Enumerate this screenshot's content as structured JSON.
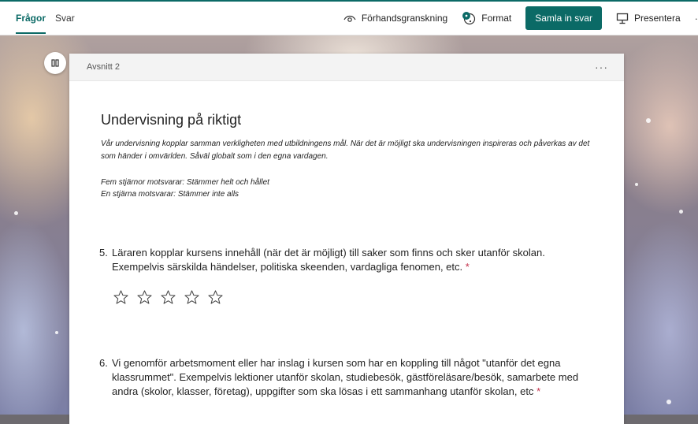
{
  "tabs": [
    {
      "label": "Frågor",
      "active": true
    },
    {
      "label": "Svar",
      "active": false
    }
  ],
  "toolbar": {
    "preview_label": "Förhandsgranskning",
    "format_label": "Format",
    "collect_label": "Samla in svar",
    "present_label": "Presentera"
  },
  "section": {
    "label": "Avsnitt 2",
    "menu": "···",
    "title": "Undervisning på riktigt",
    "description": "Vår undervisning kopplar samman verkligheten med utbildningens mål. När det är möjligt ska undervisningen inspireras och påverkas av det som händer i omvärlden. Såväl globalt som i den egna vardagen.",
    "scale_line1": "Fem stjärnor motsvarar: Stämmer helt och hållet",
    "scale_line2": "En stjärna motsvarar: Stämmer inte alls"
  },
  "questions": [
    {
      "number": "5.",
      "text": "Läraren kopplar kursens innehåll (när det är möjligt) till saker som finns och sker utanför skolan. Exempelvis särskilda händelser, politiska skeenden, vardagliga fenomen, etc.",
      "required_mark": "*",
      "rating_max": 5,
      "rating_value": 0
    },
    {
      "number": "6.",
      "text": "Vi genomför arbetsmoment eller har inslag i kursen som har en koppling till något \"utanför det egna klassrummet\". Exempelvis lektioner utanför skolan, studiebesök, gästföreläsare/besök, samarbete med andra (skolor, klasser, företag), uppgifter som ska lösas i ett sammanhang utanför skolan, etc",
      "required_mark": "*"
    }
  ],
  "colors": {
    "accent": "#0b6a66",
    "required": "#c4314b"
  },
  "icons": [
    "eye-icon",
    "format-palette-icon",
    "present-icon",
    "pause-icon",
    "star-icon"
  ]
}
